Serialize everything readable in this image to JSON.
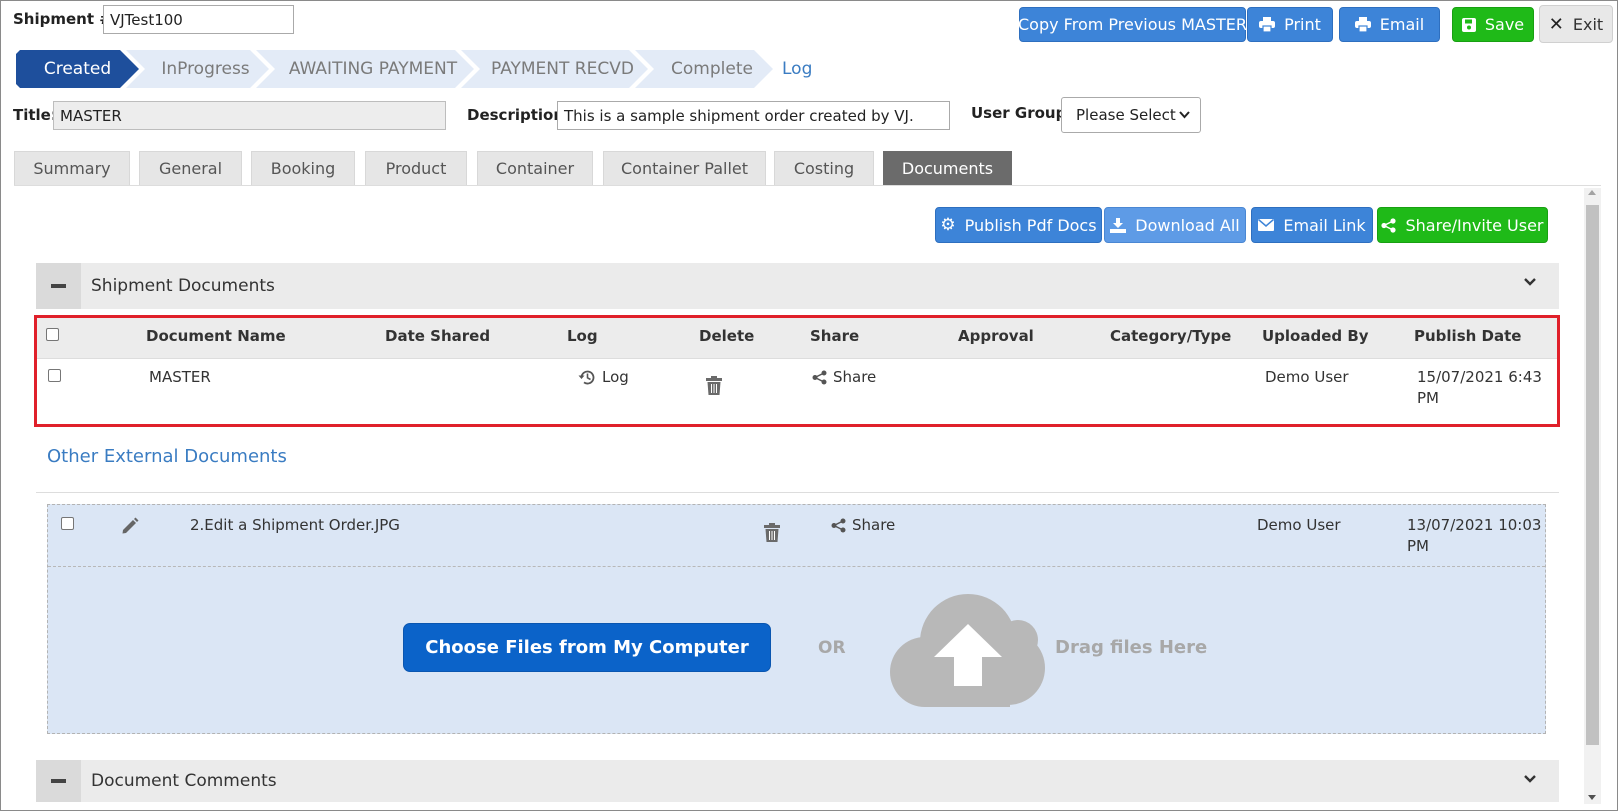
{
  "header": {
    "shipment_label": "Shipment #:",
    "shipment_value": "VJTest100",
    "copy_btn": "Copy From Previous MASTER",
    "print_btn": "Print",
    "email_btn": "Email",
    "save_btn": "Save",
    "exit_btn": "Exit"
  },
  "steps": [
    "Created",
    "InProgress",
    "AWAITING PAYMENT",
    "PAYMENT RECVD",
    "Complete"
  ],
  "log_link": "Log",
  "fields": {
    "title_label": "Title:",
    "title_value": "MASTER",
    "desc_label": "Description:",
    "desc_value": "This is a sample shipment order created by VJ.",
    "group_label": "User Group:",
    "group_value": "Please Select"
  },
  "tabs": [
    "Summary",
    "General",
    "Booking",
    "Product",
    "Container",
    "Container Pallet",
    "Costing",
    "Documents"
  ],
  "actions": {
    "publish": "Publish Pdf Docs",
    "download": "Download All",
    "email_link": "Email Link",
    "share_invite": "Share/Invite User"
  },
  "shipment_docs": {
    "title": "Shipment Documents",
    "columns": [
      "Document Name",
      "Date Shared",
      "Log",
      "Delete",
      "Share",
      "Approval",
      "Category/Type",
      "Uploaded By",
      "Publish Date"
    ],
    "row": {
      "name": "MASTER",
      "log": "Log",
      "share": "Share",
      "uploaded_by": "Demo User",
      "publish_date_1": "15/07/2021 6:43",
      "publish_date_2": "PM"
    }
  },
  "external_docs": {
    "title": "Other External Documents",
    "row": {
      "name": "2.Edit a Shipment Order.JPG",
      "share": "Share",
      "uploaded_by": "Demo User",
      "date_1": "13/07/2021 10:03",
      "date_2": "PM"
    },
    "choose_btn": "Choose Files from My Computer",
    "or": "OR",
    "drag": "Drag files Here"
  },
  "comments": {
    "title": "Document Comments"
  },
  "colors": {
    "step_active": "#1e4f9c",
    "button_blue": "#3d84d8",
    "button_green": "#1fba18",
    "highlight_red": "#e0202a",
    "link_blue": "#3a7cc2"
  }
}
